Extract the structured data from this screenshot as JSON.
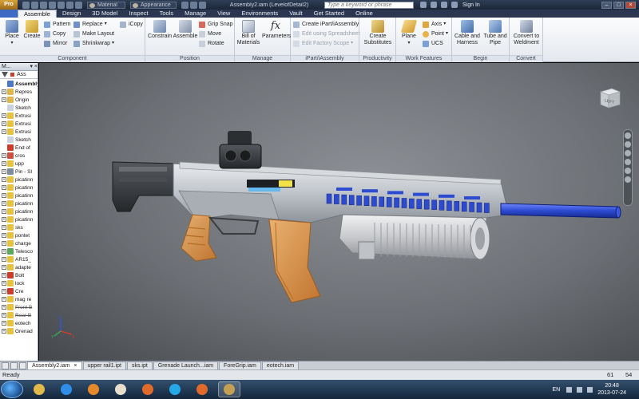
{
  "titlebar": {
    "logo": "Pro",
    "material": "Material",
    "appearance": "Appearance",
    "document_title": "Assembly2.iam (LevelofDetail2)",
    "search_placeholder": "Type a keyword or phrase",
    "sign_in": "Sign In"
  },
  "tabs": {
    "file": "",
    "items": [
      "Assemble",
      "Design",
      "3D Model",
      "Inspect",
      "Tools",
      "Manage",
      "View",
      "Environments",
      "Vault",
      "Get Started",
      "Online"
    ],
    "active": "Assemble"
  },
  "ribbon": {
    "component": {
      "label": "Component",
      "place": "Place",
      "create": "Create",
      "pattern": "Pattern",
      "copy": "Copy",
      "mirror": "Mirror",
      "replace": "Replace",
      "make_layout": "Make Layout",
      "shrinkwrap": "Shrinkwrap",
      "icopy": "iCopy"
    },
    "position": {
      "label": "Position",
      "constrain": "Constrain",
      "assemble": "Assemble",
      "grip_snap": "Grip Snap",
      "move": "Move",
      "rotate": "Rotate"
    },
    "manage": {
      "label": "Manage",
      "bom": "Bill of Materials",
      "parameters": "Parameters"
    },
    "ipart": {
      "label": "iPart/iAssembly",
      "create": "Create iPart/iAssembly",
      "edit_spreadsheet": "Edit using Spreadsheet",
      "edit_factory": "Edit Factory Scope"
    },
    "productivity": {
      "label": "Productivity",
      "create_substitutes": "Create Substitutes"
    },
    "work_features": {
      "label": "Work Features",
      "plane": "Plane",
      "axis": "Axis",
      "point": "Point",
      "ucs": "UCS"
    },
    "begin": {
      "label": "Begin",
      "cable_harness": "Cable and Harness",
      "tube_pipe": "Tube and Pipe"
    },
    "convert": {
      "label": "Convert",
      "weldment": "Convert to Weldment"
    }
  },
  "browser": {
    "header": "M...",
    "tool_label": "Ass",
    "nodes": [
      {
        "label": "Assembly",
        "icon": "assembly-icon",
        "color": "#4a78c8",
        "expand": "",
        "root": true
      },
      {
        "label": "Repres",
        "icon": "folder-icon",
        "color": "#e2b64a",
        "expand": "+"
      },
      {
        "label": "Origin",
        "icon": "folder-icon",
        "color": "#e2b64a",
        "expand": "+"
      },
      {
        "label": "Sketch",
        "icon": "sketch-icon",
        "color": "#c9d3df",
        "expand": ""
      },
      {
        "label": "Extrusi",
        "icon": "extrusion-icon",
        "color": "#e7c23c",
        "expand": "+"
      },
      {
        "label": "Extrusi",
        "icon": "extrusion-icon",
        "color": "#e7c23c",
        "expand": "+"
      },
      {
        "label": "Extrusi",
        "icon": "extrusion-icon",
        "color": "#e7c23c",
        "expand": "+"
      },
      {
        "label": "Sketch",
        "icon": "sketch-icon",
        "color": "#c9d3df",
        "expand": ""
      },
      {
        "label": "End of",
        "icon": "end-of-part-icon",
        "color": "#d03a2a",
        "expand": ""
      },
      {
        "label": "cros",
        "icon": "constraint-icon",
        "color": "#d05040",
        "expand": "+"
      },
      {
        "label": "upp",
        "icon": "part-icon",
        "color": "#e7c23c",
        "expand": "+"
      },
      {
        "label": "Pin - Sl",
        "icon": "pin-icon",
        "color": "#7f8c9c",
        "expand": "+"
      },
      {
        "label": "picatinn",
        "icon": "part-icon",
        "color": "#e7c23c",
        "expand": "+"
      },
      {
        "label": "picatinn",
        "icon": "part-icon",
        "color": "#e7c23c",
        "expand": "+"
      },
      {
        "label": "picatinn",
        "icon": "part-icon",
        "color": "#e7c23c",
        "expand": "+"
      },
      {
        "label": "picatinn",
        "icon": "part-icon",
        "color": "#e7c23c",
        "expand": "+"
      },
      {
        "label": "picatinn",
        "icon": "part-icon",
        "color": "#e7c23c",
        "expand": "+"
      },
      {
        "label": "picatinn",
        "icon": "part-icon",
        "color": "#e7c23c",
        "expand": "+"
      },
      {
        "label": "sks",
        "icon": "part-icon",
        "color": "#e7c23c",
        "expand": "+"
      },
      {
        "label": "pontet",
        "icon": "part-icon",
        "color": "#e7c23c",
        "expand": "+"
      },
      {
        "label": "charge",
        "icon": "part-icon",
        "color": "#e7c23c",
        "expand": "+"
      },
      {
        "label": "Telesco",
        "icon": "telescope-icon",
        "color": "#5aa85a",
        "expand": "+"
      },
      {
        "label": "AR15_",
        "icon": "part-icon",
        "color": "#e7c23c",
        "expand": "+"
      },
      {
        "label": "adapte",
        "icon": "part-icon",
        "color": "#e7c23c",
        "expand": "+"
      },
      {
        "label": "Bolt",
        "icon": "bolt-icon",
        "color": "#d03a2a",
        "expand": "+"
      },
      {
        "label": "lock",
        "icon": "part-icon",
        "color": "#e7c23c",
        "expand": "+"
      },
      {
        "label": "Cre",
        "icon": "constraint-icon",
        "color": "#d03a2a",
        "expand": "+"
      },
      {
        "label": "mag re",
        "icon": "part-icon",
        "color": "#e7c23c",
        "expand": "+"
      },
      {
        "label": "Front B",
        "icon": "part-icon",
        "color": "#e7c23c",
        "expand": "+",
        "strike": true
      },
      {
        "label": "Rear B",
        "icon": "part-icon",
        "color": "#e7c23c",
        "expand": "+",
        "strike": true
      },
      {
        "label": "eotech",
        "icon": "part-icon",
        "color": "#e7c23c",
        "expand": "+"
      },
      {
        "label": "Grenad",
        "icon": "part-icon",
        "color": "#e7c23c",
        "expand": "+"
      }
    ]
  },
  "viewcube": {
    "face": "LEFT"
  },
  "triad": {
    "x": "X",
    "y": "Y",
    "z": "Z"
  },
  "doc_tabs": {
    "items": [
      "Assembly2.iam",
      "upper rail1.ipt",
      "sks.ipt",
      "Grenade Launch...iam",
      "ForeGrip.iam",
      "eotech.iam"
    ],
    "active": "Assembly2.iam",
    "close_glyph": "×"
  },
  "statusbar": {
    "text": "Ready",
    "num1": "61",
    "num2": "54"
  },
  "taskbar": {
    "apps": [
      {
        "name": "explorer-app-icon",
        "color": "#e0b94a"
      },
      {
        "name": "ie-app-icon",
        "color": "#2f8fe8"
      },
      {
        "name": "media-player-app-icon",
        "color": "#e48a2a"
      },
      {
        "name": "documents-app-icon",
        "color": "#e8e0cc"
      },
      {
        "name": "firefox-app-icon",
        "color": "#e06a2a"
      },
      {
        "name": "skype-app-icon",
        "color": "#25a8e8"
      },
      {
        "name": "firefox-app-icon",
        "color": "#e06a2a"
      },
      {
        "name": "inventor-app-icon",
        "color": "#c4a054"
      }
    ],
    "language": "EN",
    "time": "20:48",
    "date": "2013-07-24"
  },
  "colors": {
    "rail_blue": "#2c4bd1",
    "magazine_orange": "#e59b4c",
    "stock_dark": "#3a3d40"
  }
}
